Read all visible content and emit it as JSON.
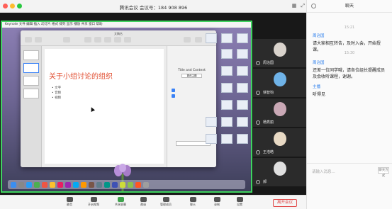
{
  "window": {
    "title": "腾讯会议 会议号：184 908 896",
    "traffic_lights": [
      "#ff5f57",
      "#febc2e",
      "#28c840"
    ]
  },
  "share": {
    "keynote_title": "关于小组讨论的组织",
    "bullets": [
      "文字",
      "音频",
      "视频"
    ],
    "panel_title": "Title and Content",
    "panel_button": "更改主题"
  },
  "participants": [
    {
      "name": "周治国"
    },
    {
      "name": "徐智钧"
    },
    {
      "name": "杨秀丽"
    },
    {
      "name": "王浩皓"
    },
    {
      "name": "郝"
    }
  ],
  "toolbar": {
    "items": [
      "静音",
      "开启视频",
      "共享屏幕",
      "邀请",
      "管理成员",
      "聊天",
      "录制",
      "设置"
    ],
    "leave_label": "离开会议"
  },
  "chat": {
    "title": "聊天",
    "messages": [
      {
        "time": "15:21",
        "sender": "周治国",
        "text": "请大家相互转告，及时入会，开始授课。"
      },
      {
        "time": "15:30",
        "sender": "周治国",
        "text": "还差一位同学哦，请各位组长提醒成员及会收听课程，谢谢。"
      },
      {
        "time": "",
        "sender": "主播",
        "text": "听得见"
      }
    ],
    "input_placeholder": "请输入消息...",
    "mode_label": "聊天方式"
  }
}
